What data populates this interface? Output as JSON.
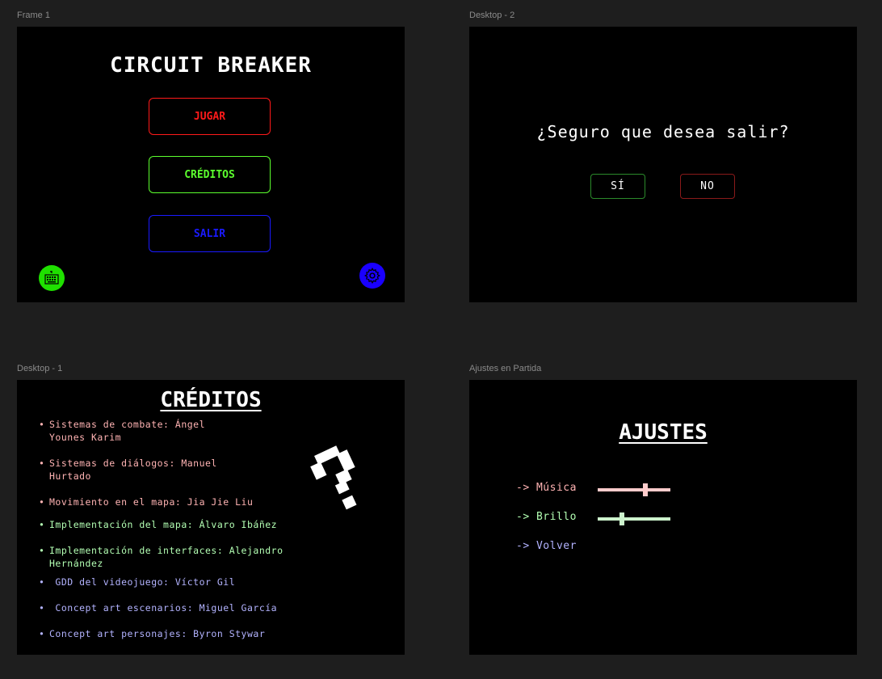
{
  "frames": {
    "frame1": "Frame 1",
    "desktop2": "Desktop - 2",
    "desktop1": "Desktop - 1",
    "ajustes": "Ajustes en Partida"
  },
  "main_menu": {
    "title": "CIRCUIT BREAKER",
    "buttons": [
      {
        "label": "JUGAR",
        "color": "#ff1a1a"
      },
      {
        "label": "CRÉDITOS",
        "color": "#5cff2e"
      },
      {
        "label": "SALIR",
        "color": "#1a1aff"
      }
    ],
    "left_icon": {
      "icon": "keyboard-icon",
      "color": "#1fe000"
    },
    "right_icon": {
      "icon": "gear-icon",
      "color": "#1a00ff"
    }
  },
  "exit_dialog": {
    "question": "¿Seguro que desea salir?",
    "yes": "SÍ",
    "no": "NO",
    "yes_color": "#2b8a2b",
    "no_color": "#8a1a1a"
  },
  "credits": {
    "title": "CRÉDITOS",
    "items": [
      {
        "text": "Sistemas de combate: Ángel\nYounes Karim",
        "color": "#ffb3b3"
      },
      {
        "text": "Sistemas de diálogos: Manuel\nHurtado",
        "color": "#ffb3b3"
      },
      {
        "text": "Movimiento en el mapa: Jia Jie Liu",
        "color": "#ffb3b3"
      },
      {
        "text": "Implementación del mapa: Álvaro Ibáñez",
        "color": "#b3ffb3"
      },
      {
        "text": "Implementación de interfaces: Alejandro\nHernández",
        "color": "#b3ffb3"
      },
      {
        "text": " GDD del videojuego: Víctor Gil",
        "color": "#b3b3ff"
      },
      {
        "text": " Concept art escenarios: Miguel García",
        "color": "#b3b3ff"
      },
      {
        "text": "Concept art personajes: Byron Stywar",
        "color": "#b3b3ff"
      }
    ],
    "bullet": "•",
    "decoration_icon": "question-mark-icon"
  },
  "settings": {
    "title": "AJUSTES",
    "options": [
      {
        "label": "-> Música",
        "color": "#ffb3b3"
      },
      {
        "label": "-> Brillo",
        "color": "#b3ffb3"
      },
      {
        "label": "-> Volver",
        "color": "#b3b3ff"
      }
    ],
    "sliders": {
      "music_level": 0.65,
      "brightness_level": 0.33,
      "music_color": "#ffcccc",
      "brightness_color": "#ccf2cc"
    }
  }
}
